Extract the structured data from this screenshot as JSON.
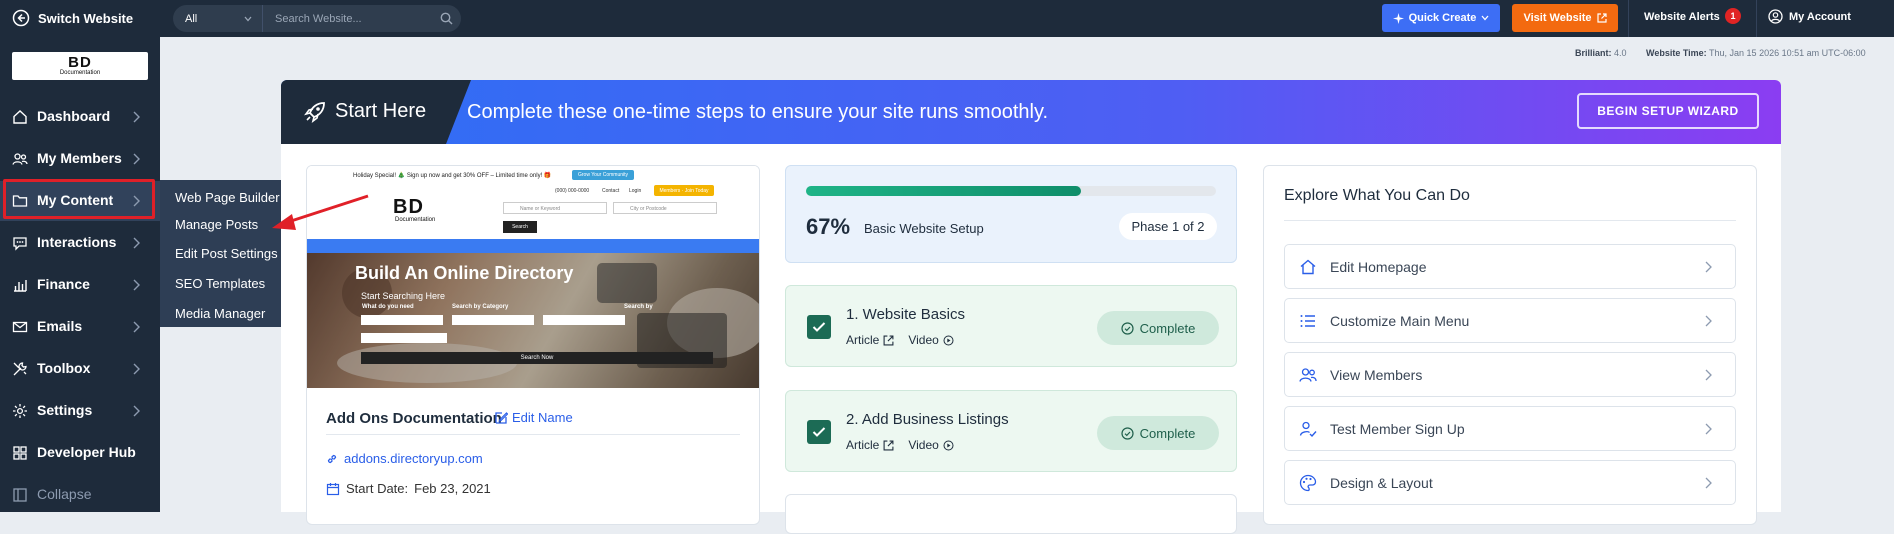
{
  "topbar": {
    "switch_label": "Switch Website",
    "search_scope": "All",
    "search_placeholder": "Search Website...",
    "quick_create": "Quick Create",
    "visit_website": "Visit Website",
    "alerts_label": "Website Alerts",
    "alerts_count": "1",
    "account_label": "My Account"
  },
  "sidebar": {
    "logo_text": "BD",
    "logo_subtext": "Documentation",
    "items": [
      {
        "label": "Dashboard",
        "icon": "house-icon"
      },
      {
        "label": "My Members",
        "icon": "users-icon"
      },
      {
        "label": "My Content",
        "icon": "folder-icon"
      },
      {
        "label": "Interactions",
        "icon": "chat-icon"
      },
      {
        "label": "Finance",
        "icon": "bar-chart-icon"
      },
      {
        "label": "Emails",
        "icon": "envelope-icon"
      },
      {
        "label": "Toolbox",
        "icon": "tools-icon"
      },
      {
        "label": "Settings",
        "icon": "gear-icon"
      },
      {
        "label": "Developer Hub",
        "icon": "grid-icon"
      }
    ],
    "collapse_label": "Collapse",
    "flyout": [
      "Web Page Builder",
      "Manage Posts",
      "Edit Post Settings",
      "SEO Templates",
      "Media Manager"
    ]
  },
  "status": {
    "brilliant_label": "Brilliant:",
    "brilliant_value": "4.0",
    "time_label": "Website Time:",
    "time_value": "Thu, Jan 15 2026 10:51 am UTC-06:00"
  },
  "banner": {
    "start_here": "Start Here",
    "message": "Complete these one-time steps to ensure your site runs smoothly.",
    "wizard_button": "BEGIN SETUP WIZARD"
  },
  "site_card": {
    "preview": {
      "promo": "Holiday Special! 🎄 Sign up now and get 30% OFF – Limited time only! 🎁",
      "promo_button": "Grow Your Community",
      "phone": "(000) 000-0000",
      "contact": "Contact",
      "login": "Login",
      "members_button": "Members · Join Today",
      "logo_text": "BD",
      "logo_subtext": "Documentation",
      "keyword_placeholder": "Name or Keyword",
      "location_placeholder": "City or Postcode",
      "search_button": "Search",
      "hero_title": "Build An Online Directory",
      "hero_subtitle": "Start Searching Here",
      "hero_field1": "What do you need",
      "hero_field2": "Search by Category",
      "hero_field3": "Search by",
      "hero_search_now": "Search Now"
    },
    "name": "Add Ons Documentation",
    "edit_name": "Edit Name",
    "url": "addons.directoryup.com",
    "start_date_label": "Start Date:",
    "start_date": "Feb 23, 2021"
  },
  "progress": {
    "value": 0.67,
    "percent_label": "67%",
    "label": "Basic Website Setup",
    "phase": "Phase 1 of 2"
  },
  "steps": [
    {
      "title": "1. Website Basics",
      "article": "Article",
      "video": "Video",
      "status": "Complete"
    },
    {
      "title": "2. Add Business Listings",
      "article": "Article",
      "video": "Video",
      "status": "Complete"
    }
  ],
  "explore": {
    "title": "Explore What You Can Do",
    "items": [
      {
        "label": "Edit Homepage",
        "icon": "home-icon"
      },
      {
        "label": "Customize Main Menu",
        "icon": "list-icon"
      },
      {
        "label": "View Members",
        "icon": "users-icon"
      },
      {
        "label": "Test Member Sign Up",
        "icon": "user-check-icon"
      },
      {
        "label": "Design & Layout",
        "icon": "palette-icon"
      }
    ]
  },
  "colors": {
    "sidebar_bg": "#1e2b3b",
    "accent_blue": "#3d6ef5",
    "accent_orange": "#f36a10",
    "highlight_red": "#e02028",
    "success_green": "#1c6b55"
  }
}
